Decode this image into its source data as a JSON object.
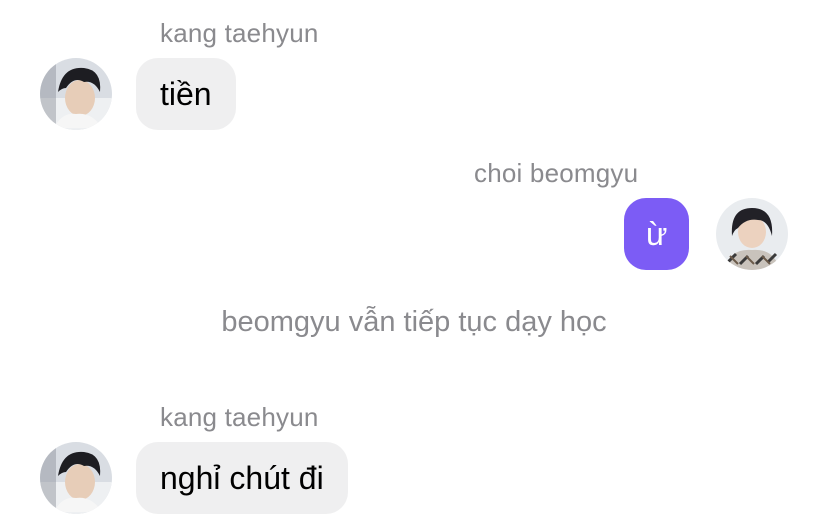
{
  "messages": [
    {
      "sender": "kang taehyun",
      "text": "tiền",
      "direction": "incoming"
    },
    {
      "sender": "choi beomgyu",
      "text": "ừ",
      "direction": "outgoing"
    },
    {
      "system": "beomgyu vẫn tiếp tục dạy học"
    },
    {
      "sender": "kang taehyun",
      "text": "nghỉ chút đi",
      "direction": "incoming"
    }
  ],
  "colors": {
    "incoming_bubble": "#efeff0",
    "outgoing_bubble": "#7c5cf5",
    "sender_name": "#8a8a8e",
    "system_text": "#8a8a8e"
  }
}
